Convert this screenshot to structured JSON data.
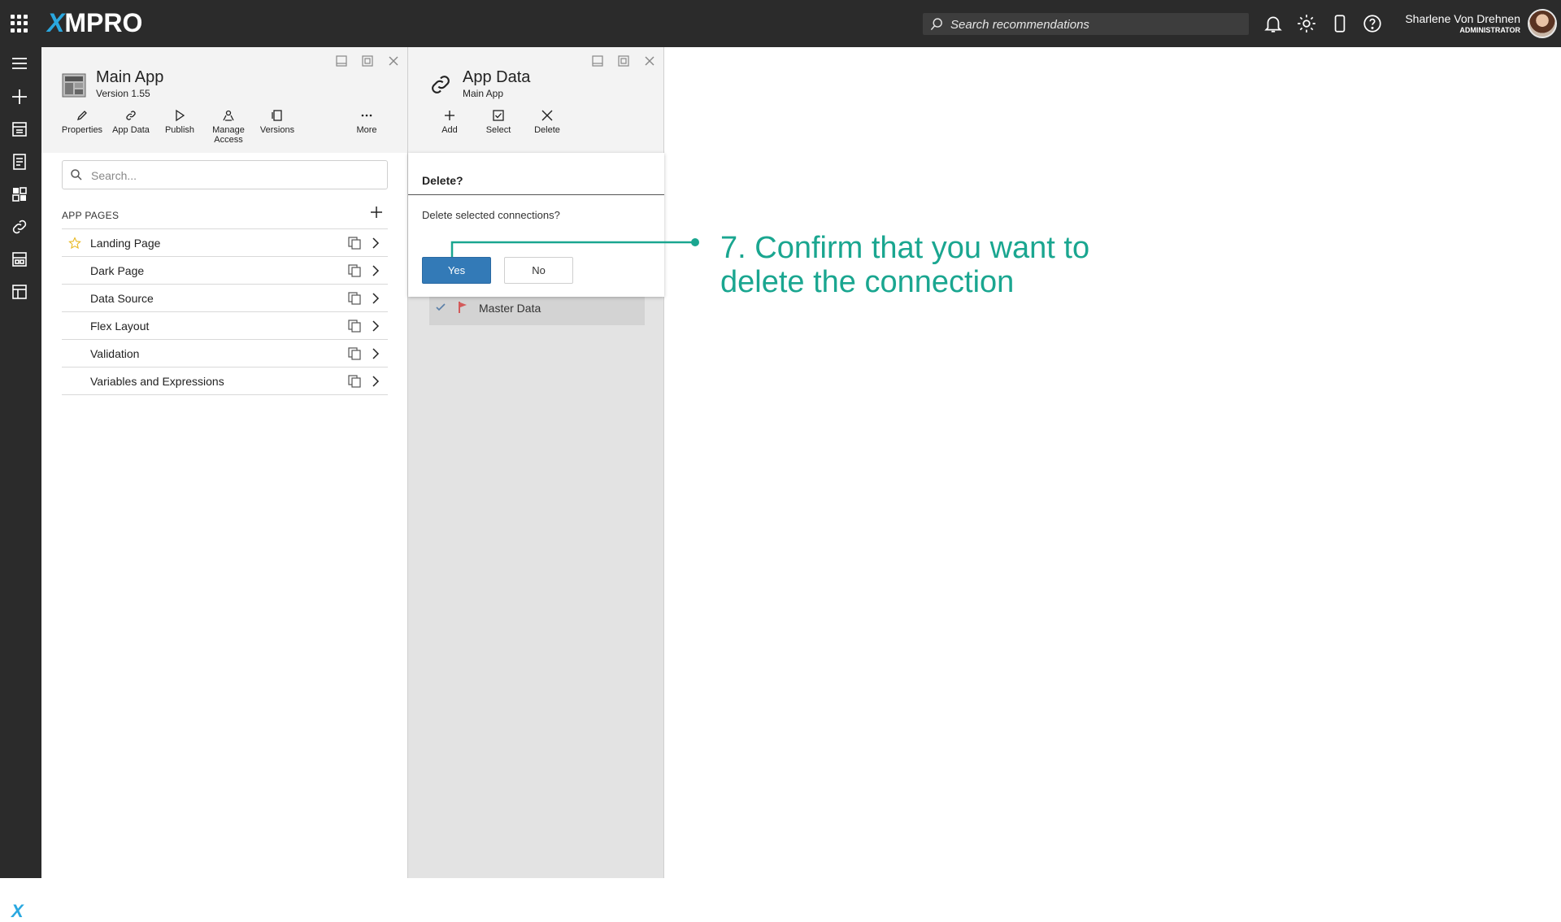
{
  "header": {
    "logo": "XMPRO",
    "search_placeholder": "Search recommendations",
    "user_name": "Sharlene Von Drehnen",
    "user_role": "ADMINISTRATOR"
  },
  "main_panel": {
    "title": "Main App",
    "subtitle": "Version 1.55",
    "toolbar": [
      {
        "label": "Properties",
        "icon": "pencil-icon"
      },
      {
        "label": "App Data",
        "icon": "link-icon"
      },
      {
        "label": "Publish",
        "icon": "play-icon"
      },
      {
        "label": "Manage Access",
        "icon": "access-icon"
      },
      {
        "label": "Versions",
        "icon": "versions-icon"
      },
      {
        "label": "More",
        "icon": "more-icon"
      }
    ],
    "search_placeholder": "Search...",
    "section_label": "APP PAGES",
    "pages": [
      {
        "label": "Landing Page",
        "starred": true
      },
      {
        "label": "Dark Page"
      },
      {
        "label": "Data Source"
      },
      {
        "label": "Flex Layout"
      },
      {
        "label": "Validation"
      },
      {
        "label": "Variables and Expressions"
      }
    ]
  },
  "data_panel": {
    "title": "App Data",
    "subtitle": "Main App",
    "toolbar": [
      {
        "label": "Add",
        "icon": "plus-icon"
      },
      {
        "label": "Select",
        "icon": "checkbox-icon"
      },
      {
        "label": "Delete",
        "icon": "close-icon"
      }
    ],
    "item": {
      "label": "Master Data",
      "checked": true
    }
  },
  "dialog": {
    "title": "Delete?",
    "message": "Delete selected connections?",
    "yes_label": "Yes",
    "no_label": "No"
  },
  "annotation": {
    "text": "7. Confirm that you want to delete the connection",
    "color": "#1aa690"
  },
  "colors": {
    "topbar": "#2b2b2b",
    "primary_button": "#337ab7",
    "brand_accent": "#2aa8e0"
  }
}
